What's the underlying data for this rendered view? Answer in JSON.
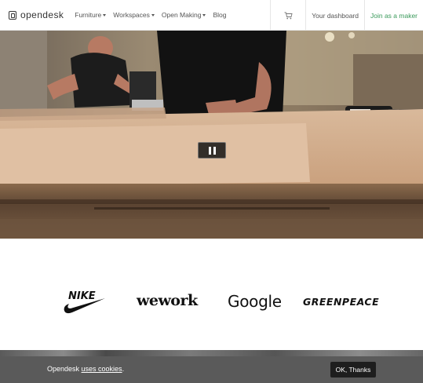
{
  "nav": {
    "brand": "opendesk",
    "menu": [
      {
        "label": "Furniture",
        "dropdown": true
      },
      {
        "label": "Workspaces",
        "dropdown": true
      },
      {
        "label": "Open Making",
        "dropdown": true
      },
      {
        "label": "Blog",
        "dropdown": false
      }
    ],
    "cart_icon": "cart-icon",
    "dashboard": "Your dashboard",
    "join": "Join as a maker",
    "accent": "#3a9a5b"
  },
  "hero": {
    "video_state": "playing",
    "control_icon": "pause-icon"
  },
  "logos": {
    "nike": "NIKE",
    "wework": "wework",
    "google": "Google",
    "greenpeace": "GREENPEACE"
  },
  "cookie": {
    "prefix": "Opendesk ",
    "link": "uses cookies",
    "suffix": ".",
    "button": "OK, Thanks"
  }
}
